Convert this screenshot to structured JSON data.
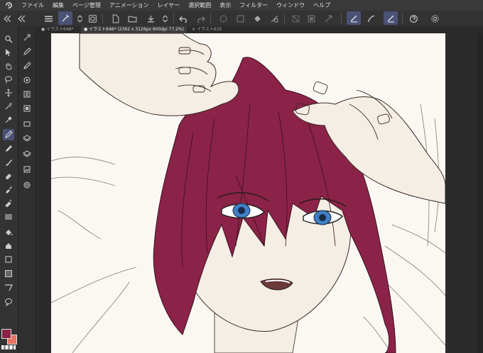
{
  "menu": {
    "logo_icon": "clip-studio-logo-icon",
    "items": [
      "ファイル",
      "編集",
      "ページ管理",
      "アニメーション",
      "レイヤー",
      "選択範囲",
      "表示",
      "フィルター",
      "ウィンドウ",
      "ヘルプ"
    ]
  },
  "tabs": [
    {
      "label": "イラスト648*",
      "active": false
    },
    {
      "label": "イラスト646* (2362 x 3126px 600dpi 77.2%)",
      "active": true
    },
    {
      "label": "イラスト635",
      "active": false
    }
  ],
  "colors": {
    "main_color": "#8b2348",
    "sub_color": "#e8735f",
    "hair": "#8b2348",
    "skin": "#f5eee4",
    "eyes": "#3f7fc6",
    "accent": "#4a5275"
  }
}
